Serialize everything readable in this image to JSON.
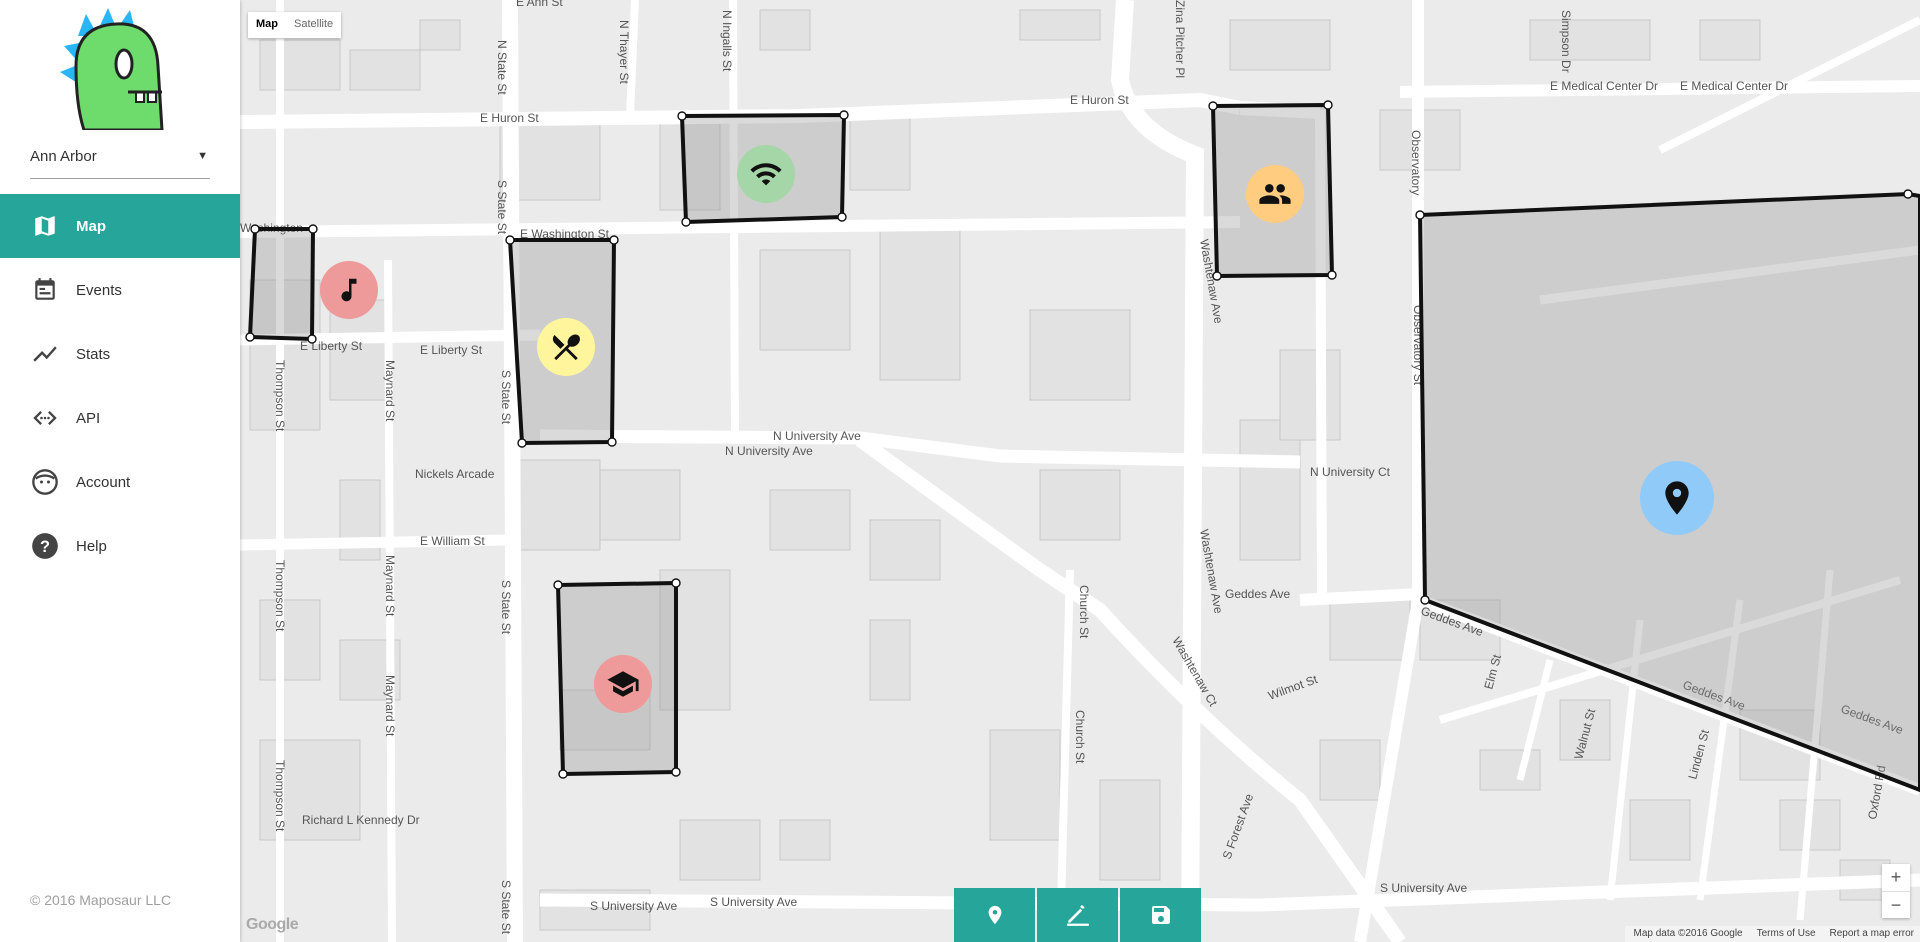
{
  "sidebar": {
    "city": "Ann Arbor",
    "nav": [
      {
        "label": "Map",
        "icon": "map-icon",
        "active": true
      },
      {
        "label": "Events",
        "icon": "calendar-icon"
      },
      {
        "label": "Stats",
        "icon": "chart-line-icon"
      },
      {
        "label": "API",
        "icon": "code-icon"
      },
      {
        "label": "Account",
        "icon": "face-icon"
      },
      {
        "label": "Help",
        "icon": "help-icon"
      }
    ],
    "copyright": "© 2016 Maposaur LLC"
  },
  "map": {
    "type_buttons": [
      "Map",
      "Satellite"
    ],
    "streets": [
      "E Huron St",
      "E Huron St",
      "E Washington St",
      "Washington",
      "E Liberty St",
      "E Liberty St",
      "N University Ave",
      "N University Ave",
      "E William St",
      "Nickels Arcade",
      "Geddes Ave",
      "Geddes Ave",
      "Geddes Ave",
      "Geddes Ave",
      "S University Ave",
      "S University Ave",
      "S University Ave",
      "E Medical Center Dr",
      "E Medical Center Dr",
      "Washtenaw Ave",
      "Washtenaw Ave",
      "S State St",
      "S State St",
      "S State St",
      "S State St",
      "N State St",
      "N Ingalls St",
      "N Thayer St",
      "Thompson St",
      "Thompson St",
      "Thompson St",
      "Maynard St",
      "Maynard St",
      "Maynard St",
      "Church St",
      "Church St",
      "Richard L Kennedy Dr",
      "Observatory",
      "Observatory St",
      "N University Ct",
      "S Forest Ave",
      "Oxford Rd",
      "Washtenaw Ct",
      "Wilmot St",
      "Linden St",
      "Walnut St",
      "Elm St",
      "E Ann St",
      "Simpson Dr",
      "Zina Pitcher Pl"
    ],
    "attribution": [
      "Map data ©2016 Google",
      "Terms of Use",
      "Report a map error"
    ],
    "google_logo": "Google",
    "zoom": [
      "+",
      "−"
    ]
  },
  "markers": [
    {
      "name": "music",
      "icon": "music-note-icon",
      "color": "#ef9a9a"
    },
    {
      "name": "food",
      "icon": "utensils-icon",
      "color": "#fff59d"
    },
    {
      "name": "wifi",
      "icon": "wifi-icon",
      "color": "#a5d6a7"
    },
    {
      "name": "people",
      "icon": "people-icon",
      "color": "#ffcc80"
    },
    {
      "name": "education",
      "icon": "graduation-cap-icon",
      "color": "#ef9a9a"
    },
    {
      "name": "location",
      "icon": "map-pin-icon",
      "color": "#90caf9"
    }
  ],
  "toolbar": [
    "add-marker",
    "draw",
    "save"
  ],
  "colors": {
    "accent": "#26a69a",
    "logo_green": "#6ddc6d",
    "logo_blue": "#29b6f6"
  }
}
